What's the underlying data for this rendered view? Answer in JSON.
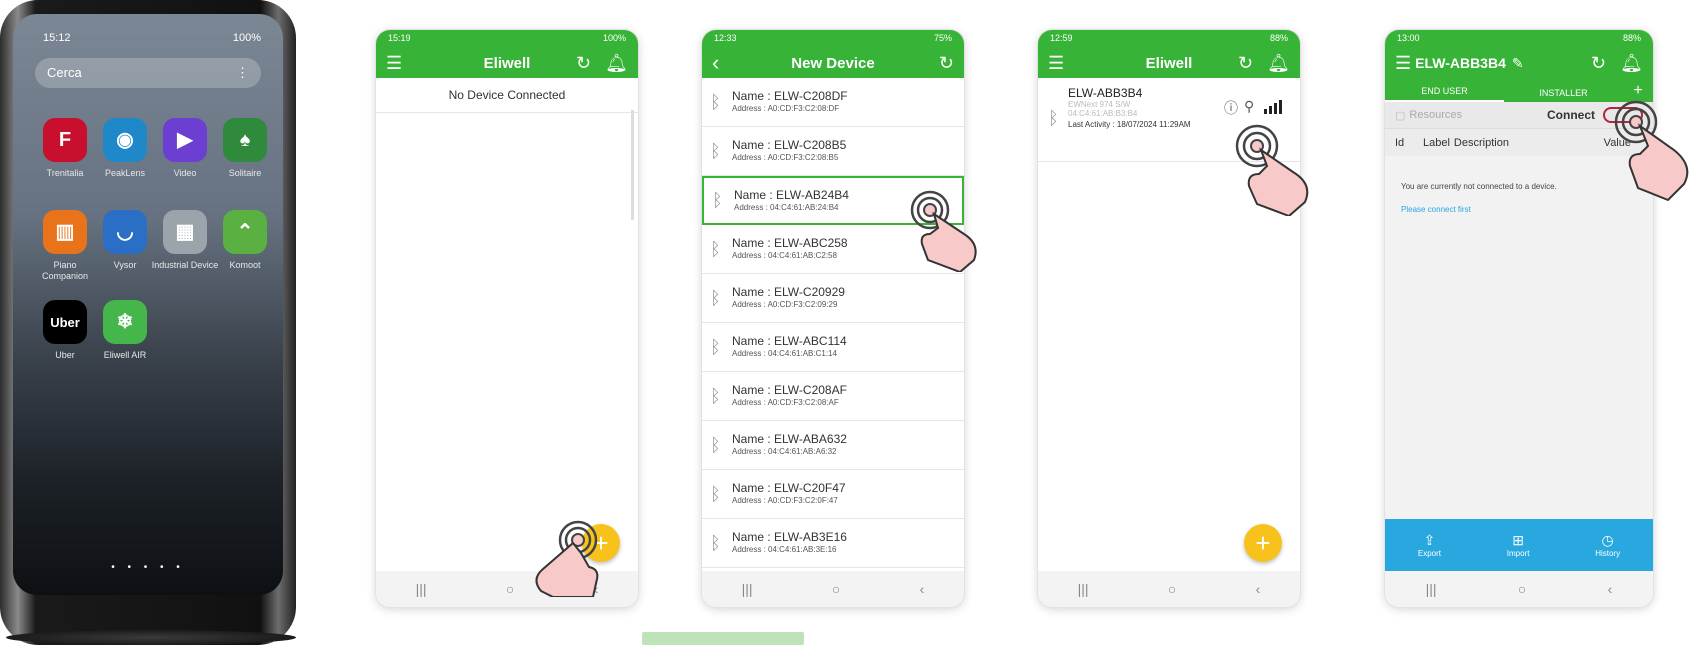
{
  "phone1": {
    "time": "15:12",
    "status_right": "100%",
    "search_placeholder": "Cerca",
    "apps": [
      {
        "label": "Trenitalia",
        "icon": "trenitalia-icon",
        "color": "#c8102e",
        "glyph": "F"
      },
      {
        "label": "PeakLens",
        "icon": "peaklens-icon",
        "color": "#1e88c9",
        "glyph": "◉"
      },
      {
        "label": "Video",
        "icon": "video-icon",
        "color": "#6a3fd1",
        "glyph": "▶"
      },
      {
        "label": "Solitaire",
        "icon": "solitaire-icon",
        "color": "#2f8a3c",
        "glyph": "♠"
      },
      {
        "label": "Piano Companion",
        "icon": "piano-icon",
        "color": "#e8731a",
        "glyph": "▥"
      },
      {
        "label": "Vysor",
        "icon": "vysor-icon",
        "color": "#2a6ec5",
        "glyph": "◡"
      },
      {
        "label": "Industrial Device",
        "icon": "industrial-device-icon",
        "color": "#9aa4aa",
        "glyph": "▦"
      },
      {
        "label": "Komoot",
        "icon": "komoot-icon",
        "color": "#5ab040",
        "glyph": "⌃"
      },
      {
        "label": "Uber",
        "icon": "uber-icon",
        "color": "#000000",
        "glyph": "Uber"
      },
      {
        "label": "Eliwell AIR",
        "icon": "eliwell-air-icon",
        "color": "#45b649",
        "glyph": "❄"
      }
    ],
    "page_dots": "• • • • •",
    "nav": [
      "|||",
      "○",
      "‹"
    ]
  },
  "screen2": {
    "time": "15:19",
    "battery": "100%",
    "title": "Eliwell",
    "message": "No Device Connected",
    "fab": "+",
    "nav": [
      "|||",
      "○",
      "‹"
    ]
  },
  "screen3": {
    "time": "12:33",
    "battery": "75%",
    "title": "New Device",
    "devices": [
      {
        "name": "Name : ELW-C208DF",
        "address": "Address : A0:CD:F3:C2:08:DF"
      },
      {
        "name": "Name : ELW-C208B5",
        "address": "Address : A0:CD:F3:C2:08:B5"
      },
      {
        "name": "Name : ELW-AB24B4",
        "address": "Address : 04:C4:61:AB:24:B4"
      },
      {
        "name": "Name : ELW-ABC258",
        "address": "Address : 04:C4:61:AB:C2:58"
      },
      {
        "name": "Name : ELW-C20929",
        "address": "Address : A0:CD:F3:C2:09:29"
      },
      {
        "name": "Name : ELW-ABC114",
        "address": "Address : 04:C4:61:AB:C1:14"
      },
      {
        "name": "Name : ELW-C208AF",
        "address": "Address : A0:CD:F3:C2:08:AF"
      },
      {
        "name": "Name : ELW-ABA632",
        "address": "Address : 04:C4:61:AB:A6:32"
      },
      {
        "name": "Name : ELW-C20F47",
        "address": "Address : A0:CD:F3:C2:0F:47"
      },
      {
        "name": "Name : ELW-AB3E16",
        "address": "Address : 04:C4:61:AB:3E:16"
      }
    ],
    "selected_index": 2,
    "nav": [
      "|||",
      "○",
      "‹"
    ]
  },
  "screen4": {
    "time": "12:59",
    "battery": "88%",
    "title": "Eliwell",
    "device_name": "ELW-ABB3B4",
    "device_model": "EWNext 974 S/W",
    "device_address": "04:C4:61:AB:B3:B4",
    "last_activity": "Last Activity : 18/07/2024 11:29AM",
    "fab": "+",
    "nav": [
      "|||",
      "○",
      "‹"
    ]
  },
  "screen5": {
    "time": "13:00",
    "battery": "88%",
    "title": "ELW-ABB3B4",
    "tabs": [
      "END USER",
      "INSTALLER"
    ],
    "resources": "Resources",
    "connect": "Connect",
    "columns": [
      "Id",
      "Label",
      "Description",
      "Value"
    ],
    "not_connected": "You are currently not connected to a device.",
    "please_connect": "Please connect first",
    "bottom_actions": [
      "Export",
      "Import",
      "History"
    ],
    "nav": [
      "|||",
      "○",
      "‹"
    ]
  },
  "colors": {
    "green": "#37b337",
    "fab": "#f6c21b",
    "blue": "#29a8e0"
  }
}
